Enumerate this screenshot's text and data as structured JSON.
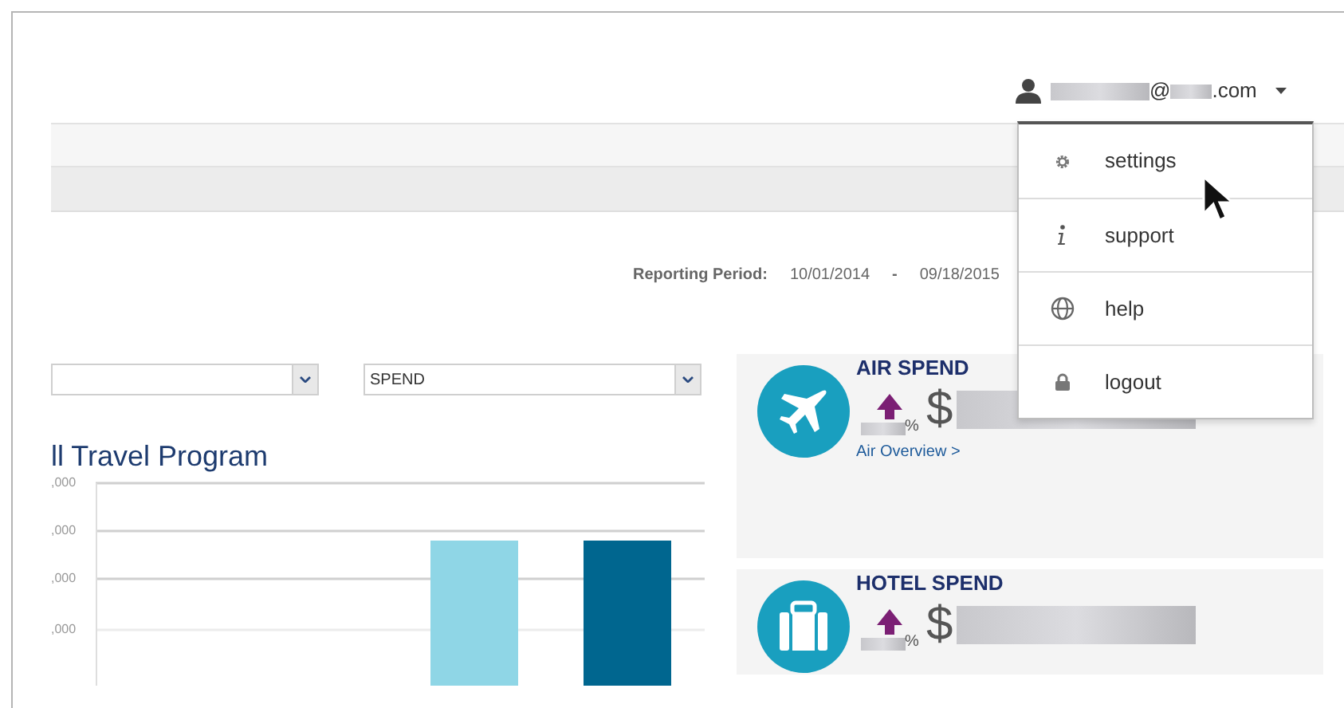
{
  "account": {
    "email_at": "@",
    "email_domain": ".com"
  },
  "user_menu": {
    "items": [
      {
        "kind": "gear",
        "label": "settings"
      },
      {
        "kind": "info",
        "label": "support"
      },
      {
        "kind": "globe",
        "label": "help"
      },
      {
        "kind": "lock",
        "label": "logout"
      }
    ]
  },
  "reporting_period": {
    "label": "Reporting Period:",
    "start": "10/01/2014",
    "separator": "-",
    "end": "09/18/2015"
  },
  "filters": [
    {
      "kind": "dropdown"
    },
    {
      "kind": "dropdown",
      "value": "SPEND"
    }
  ],
  "chart": {
    "title": "ll Travel Program",
    "tick_labels": [
      ",000",
      ",000",
      ",000",
      ",000"
    ],
    "bars": [
      {
        "color": "#8fd6e6"
      },
      {
        "color": "#00668f"
      }
    ]
  },
  "spend_cards": [
    {
      "kind": "air",
      "title": "AIR SPEND",
      "currency": "$",
      "percent": "%",
      "link": "Air Overview >"
    },
    {
      "kind": "hotel",
      "title": "HOTEL SPEND",
      "currency": "$",
      "percent": "%"
    }
  ]
}
